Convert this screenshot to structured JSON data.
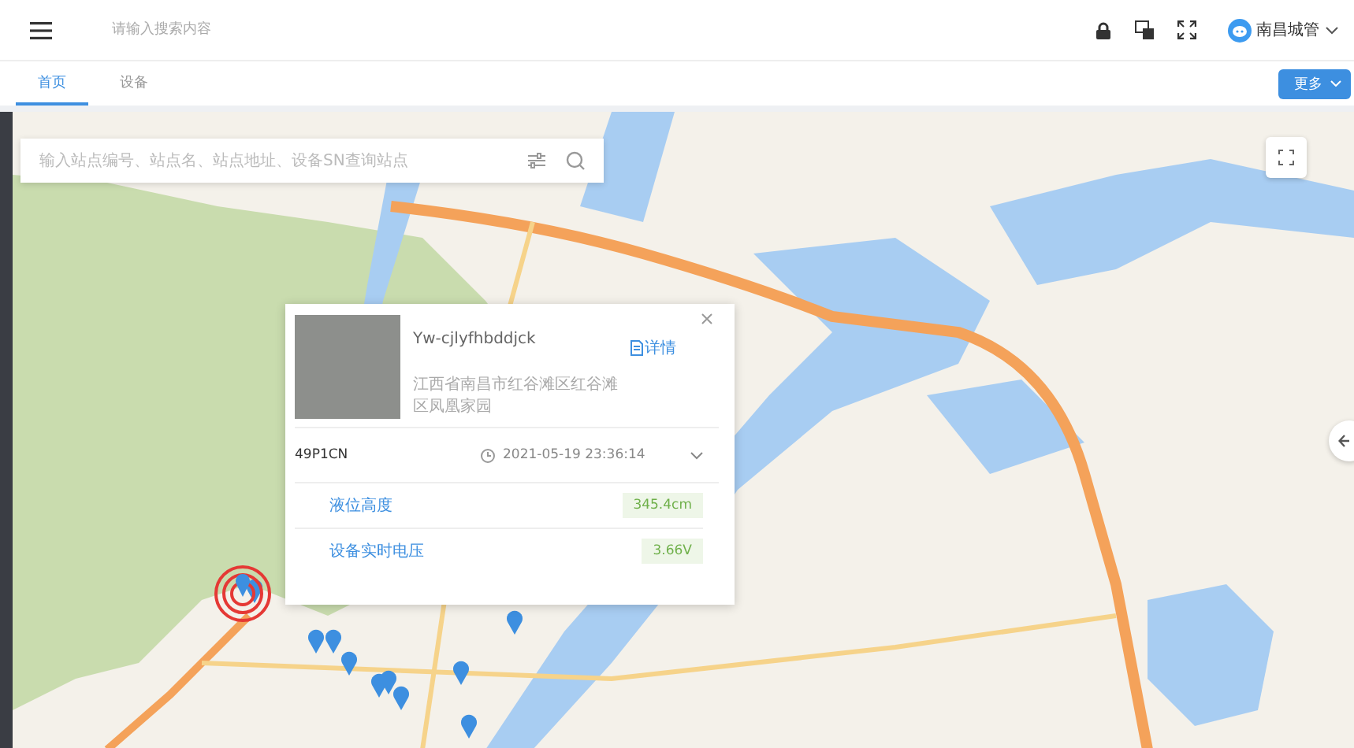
{
  "header": {
    "search": {
      "placeholder": "请输入搜索内容"
    },
    "user": {
      "name": "南昌城管"
    }
  },
  "tabs": [
    {
      "label": "首页",
      "selected": true
    },
    {
      "label": "设备",
      "selected": false
    }
  ],
  "more_button": {
    "label": "更多"
  },
  "map": {
    "search": {
      "placeholder": "输入站点编号、站点名、站点地址、设备SN查询站点"
    }
  },
  "popup": {
    "title": "Yw-cjlyfhbddjck",
    "detail_link": "详情",
    "address": "江西省南昌市红谷滩区红谷滩区凤凰家园",
    "device": {
      "id": "49P1CN",
      "time": "2021-05-19 23:36:14",
      "expanded": true,
      "readings": [
        {
          "label": "液位高度",
          "value": "345.4cm"
        },
        {
          "label": "设备实时电压",
          "value": "3.66V"
        }
      ]
    }
  }
}
